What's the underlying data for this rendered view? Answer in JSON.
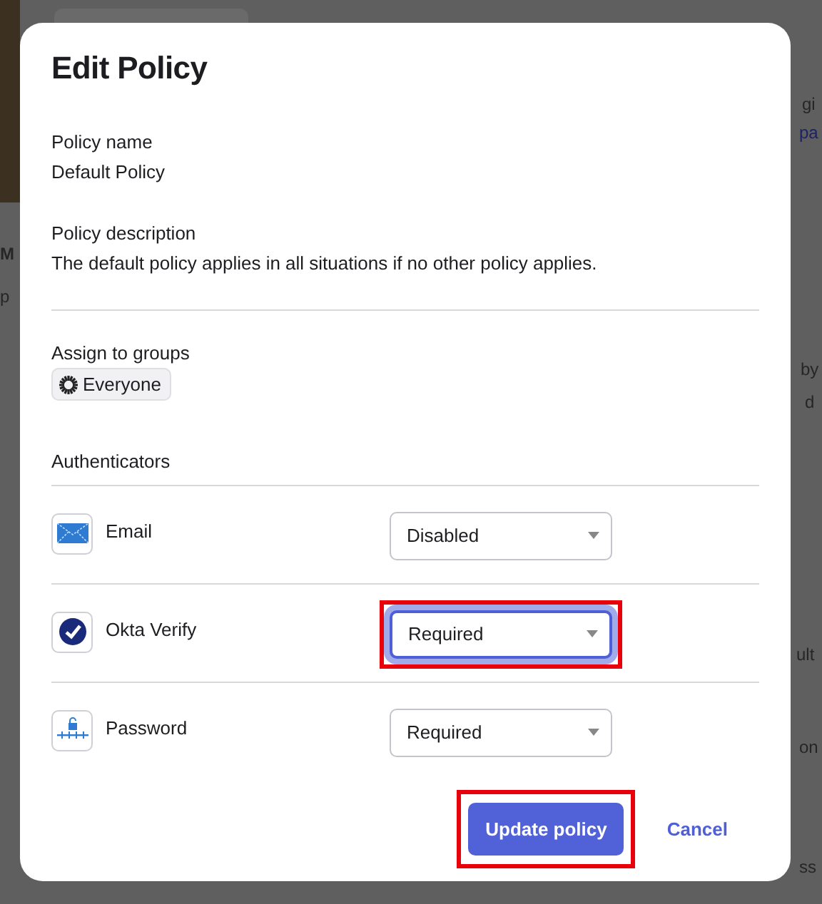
{
  "backdrop": {
    "fragments": [
      {
        "text": "gi",
        "kind": "text"
      },
      {
        "text": "pa",
        "kind": "link"
      },
      {
        "text": "M",
        "kind": "heading"
      },
      {
        "text": "p",
        "kind": "text"
      },
      {
        "text": "by",
        "kind": "text"
      },
      {
        "text": "d",
        "kind": "text"
      },
      {
        "text": "ult",
        "kind": "text"
      },
      {
        "text": "on",
        "kind": "text"
      },
      {
        "text": "ss",
        "kind": "text"
      }
    ]
  },
  "dialog": {
    "title": "Edit Policy",
    "fields": [
      {
        "label": "Policy name",
        "value": "Default Policy"
      },
      {
        "label": "Policy description",
        "value": "The default policy applies in all situations if no other policy applies."
      }
    ],
    "groups": {
      "label": "Assign to groups",
      "chips": [
        "Everyone"
      ]
    },
    "authenticators": {
      "label": "Authenticators",
      "rows": [
        {
          "name": "Email",
          "kind": "email",
          "value": "Disabled",
          "focused": false,
          "highlighted": false
        },
        {
          "name": "Okta Verify",
          "kind": "verify",
          "value": "Required",
          "focused": true,
          "highlighted": true
        },
        {
          "name": "Password",
          "kind": "password",
          "value": "Required",
          "focused": false,
          "highlighted": false
        }
      ]
    },
    "buttons": [
      {
        "label": "Update policy",
        "kind": "primary",
        "highlighted": true
      },
      {
        "label": "Cancel",
        "kind": "link",
        "highlighted": false
      }
    ]
  }
}
